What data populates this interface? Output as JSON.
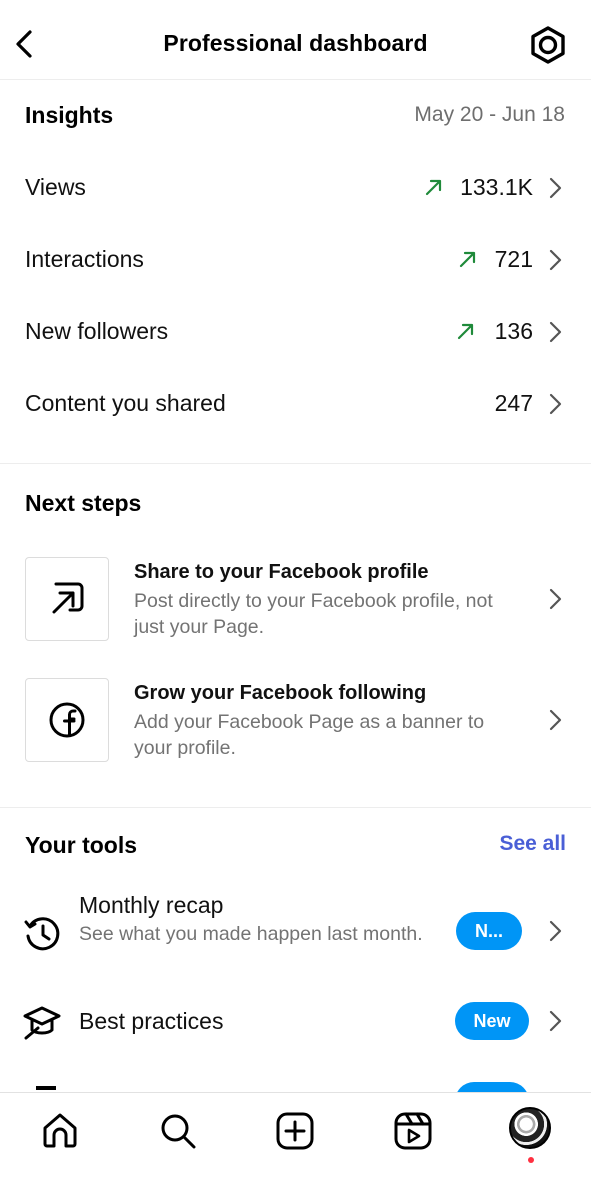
{
  "header": {
    "title": "Professional dashboard"
  },
  "insights": {
    "title": "Insights",
    "date_range": "May 20 - Jun 18",
    "rows": [
      {
        "label": "Views",
        "value": "133.1K",
        "trend": "up"
      },
      {
        "label": "Interactions",
        "value": "721",
        "trend": "up"
      },
      {
        "label": "New followers",
        "value": "136",
        "trend": "up"
      },
      {
        "label": "Content you shared",
        "value": "247",
        "trend": "none"
      }
    ]
  },
  "next_steps": {
    "title": "Next steps",
    "cards": [
      {
        "title": "Share to your Facebook profile",
        "desc": "Post directly to your Facebook profile, not just your Page.",
        "icon": "share-arrow-icon"
      },
      {
        "title": "Grow your Facebook following",
        "desc": "Add your Facebook Page as a banner to your profile.",
        "icon": "facebook-icon"
      }
    ]
  },
  "tools": {
    "title": "Your tools",
    "see_all": "See all",
    "items": [
      {
        "title": "Monthly recap",
        "desc": "See what you made happen last month.",
        "badge": "N...",
        "icon": "history-icon"
      },
      {
        "title": "Best practices",
        "desc": "",
        "badge": "New",
        "icon": "graduation-cap-icon"
      }
    ]
  },
  "colors": {
    "trend_up": "#1f8a3a",
    "badge": "#0095f6",
    "link": "#4a5fd6",
    "muted": "#737373"
  }
}
